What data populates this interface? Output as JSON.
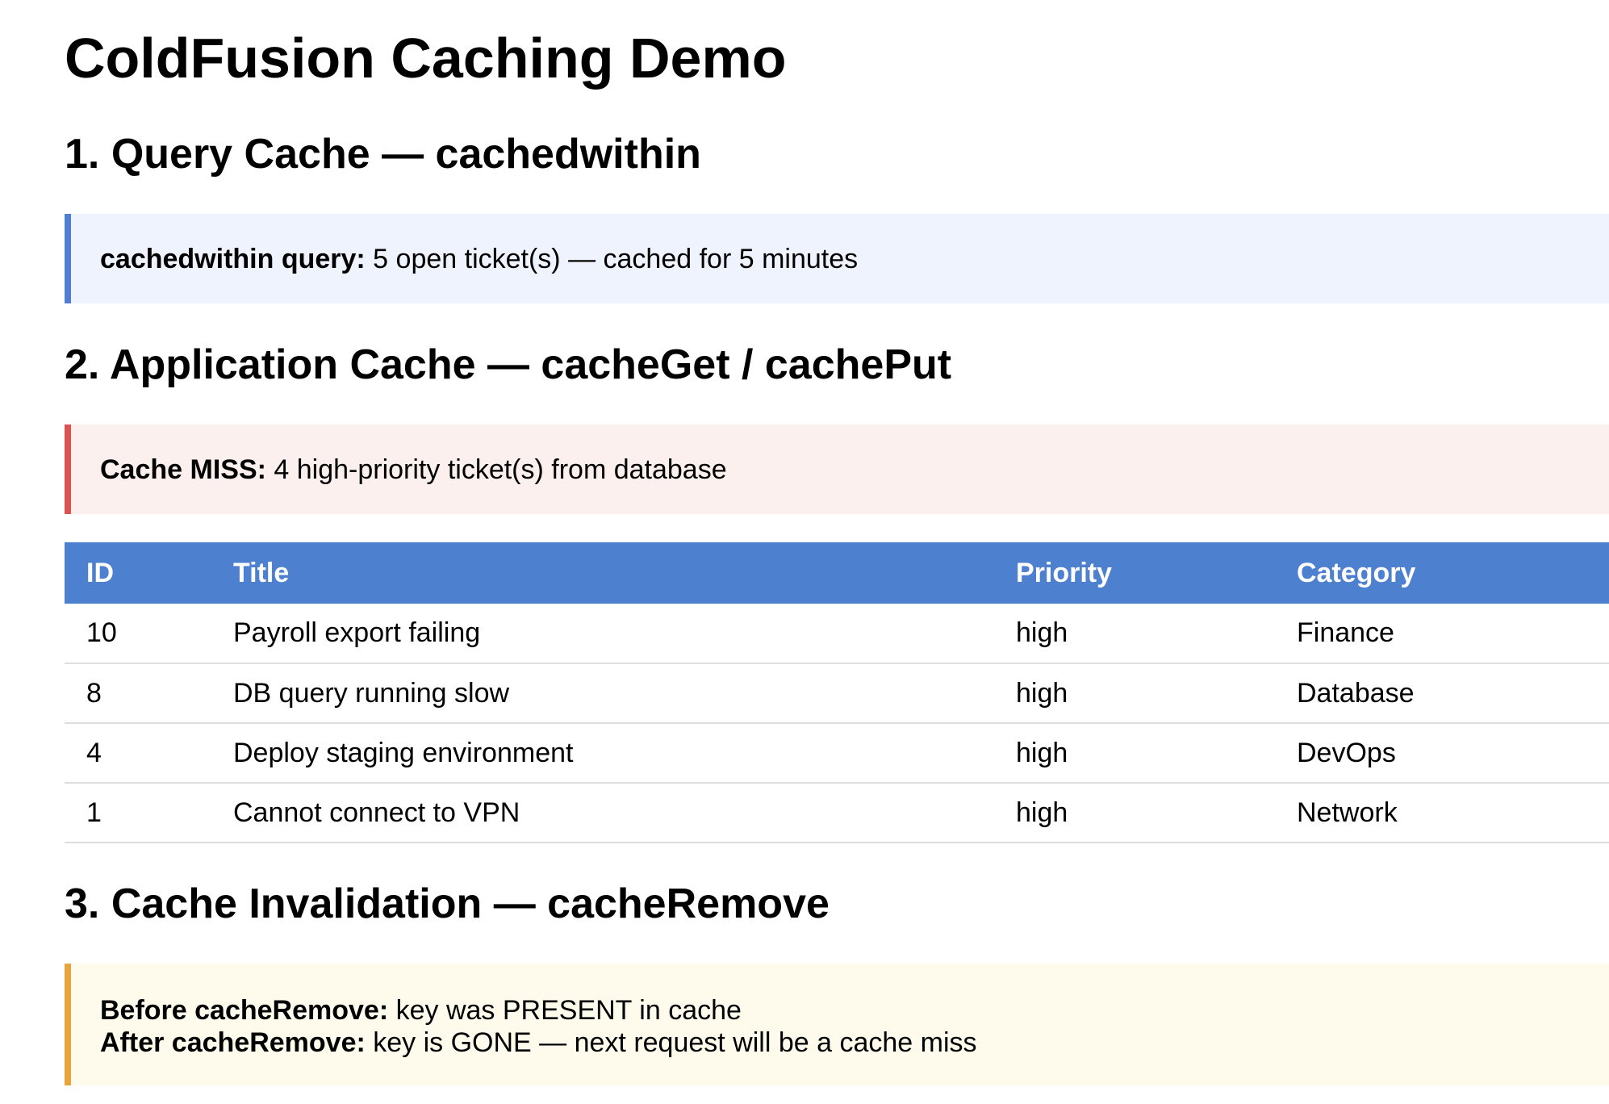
{
  "page": {
    "title": "ColdFusion Caching Demo"
  },
  "sections": [
    {
      "heading": "1. Query Cache — cachedwithin",
      "callout": {
        "lines": [
          {
            "label": "cachedwithin query:",
            "text": " 5 open ticket(s) — cached for 5 minutes"
          }
        ],
        "accent_color": "#4e7fd0",
        "background": "#eff3fd"
      }
    },
    {
      "heading": "2. Application Cache — cacheGet / cachePut",
      "callout": {
        "lines": [
          {
            "label": "Cache MISS:",
            "text": " 4 high-priority ticket(s) from database"
          }
        ],
        "accent_color": "#db5452",
        "background": "#fcf0ee"
      },
      "table": {
        "header_color": "#4e80d0",
        "columns": [
          "ID",
          "Title",
          "Priority",
          "Category"
        ],
        "rows": [
          [
            "10",
            "Payroll export failing",
            "high",
            "Finance"
          ],
          [
            "8",
            "DB query running slow",
            "high",
            "Database"
          ],
          [
            "4",
            "Deploy staging environment",
            "high",
            "DevOps"
          ],
          [
            "1",
            "Cannot connect to VPN",
            "high",
            "Network"
          ]
        ]
      }
    },
    {
      "heading": "3. Cache Invalidation — cacheRemove",
      "callout": {
        "lines": [
          {
            "label": "Before cacheRemove:",
            "text": " key was PRESENT in cache"
          },
          {
            "label": "After cacheRemove:",
            "text": " key is GONE — next request will be a cache miss"
          }
        ],
        "accent_color": "#e8a53d",
        "background": "#fefbec"
      }
    }
  ]
}
